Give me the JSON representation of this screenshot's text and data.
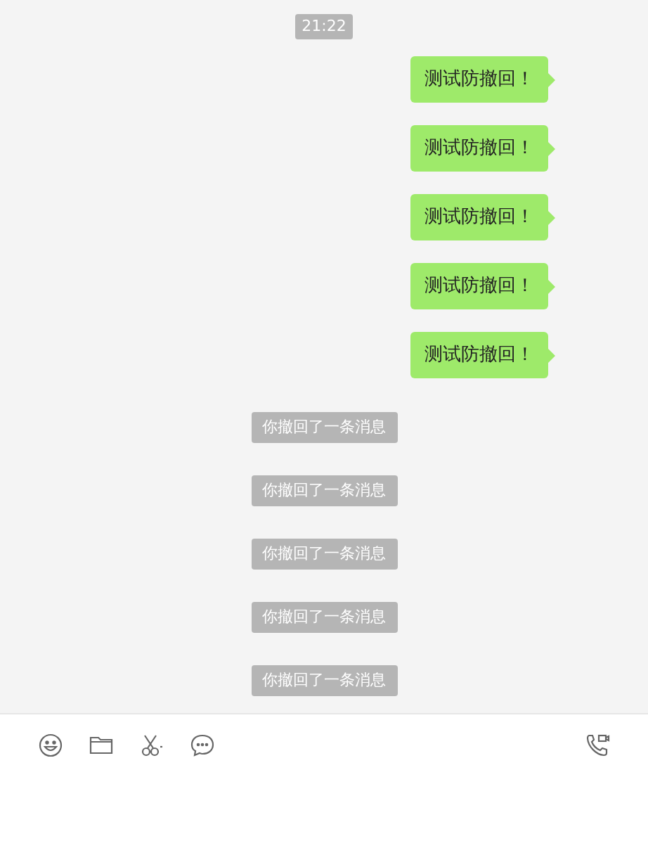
{
  "timestamp": "21:22",
  "messages": [
    {
      "kind": "sent",
      "text": "测试防撤回！"
    },
    {
      "kind": "sent",
      "text": "测试防撤回！"
    },
    {
      "kind": "sent",
      "text": "测试防撤回！"
    },
    {
      "kind": "sent",
      "text": "测试防撤回！"
    },
    {
      "kind": "sent",
      "text": "测试防撤回！"
    },
    {
      "kind": "notice",
      "text": "你撤回了一条消息"
    },
    {
      "kind": "notice",
      "text": "你撤回了一条消息"
    },
    {
      "kind": "notice",
      "text": "你撤回了一条消息"
    },
    {
      "kind": "notice",
      "text": "你撤回了一条消息"
    },
    {
      "kind": "notice",
      "text": "你撤回了一条消息"
    }
  ]
}
